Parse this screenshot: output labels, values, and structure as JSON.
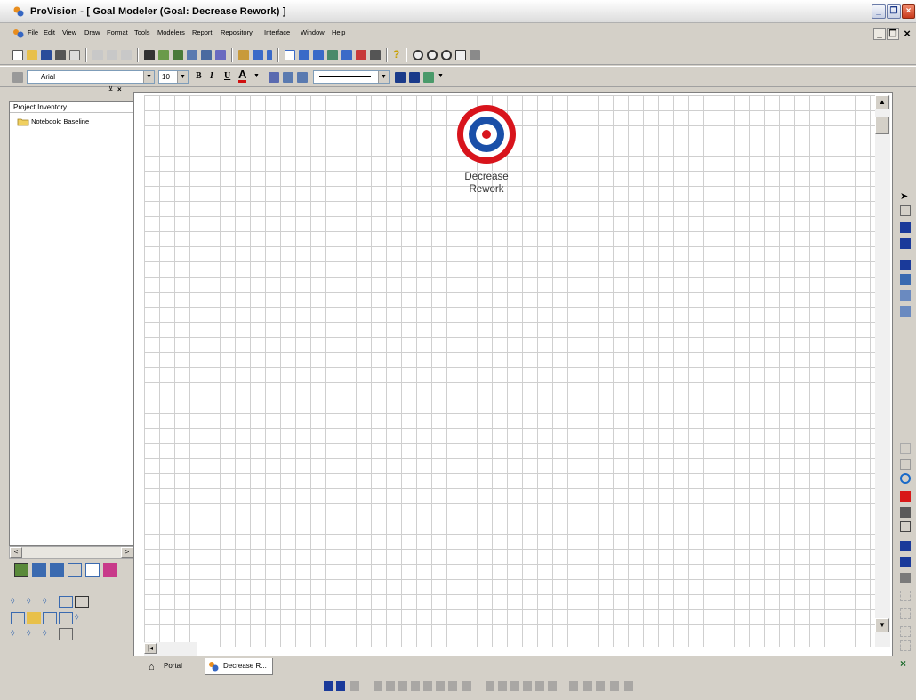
{
  "window": {
    "title": "ProVision - [ Goal Modeler (Goal: Decrease Rework) ]",
    "minimize": "_",
    "restore": "❐",
    "close": "×"
  },
  "menu": {
    "items": [
      "File",
      "Edit",
      "View",
      "Draw",
      "Format",
      "Tools",
      "Modelers",
      "Report",
      "Repository",
      "Interface",
      "Window",
      "Help"
    ],
    "mdi_minimize": "_",
    "mdi_restore": "❐",
    "mdi_close": "×"
  },
  "format_toolbar": {
    "font": "Arial",
    "size": "10",
    "bold": "B",
    "italic": "I",
    "underline": "U",
    "font_color": "A"
  },
  "inventory": {
    "header": "Project Inventory",
    "items": [
      {
        "label": "Notebook: Baseline",
        "icon": "folder-icon"
      }
    ]
  },
  "canvas": {
    "goal": {
      "label_line1": "Decrease",
      "label_line2": "Rework",
      "icon": "target-icon"
    }
  },
  "tabs": [
    {
      "label": "Portal",
      "icon": "portal-icon"
    },
    {
      "label": "Decrease R...",
      "icon": "goal-modeler-icon"
    }
  ],
  "colors": {
    "target_red": "#d8141c",
    "target_blue": "#1a4fa8",
    "grid": "#cfcfcf"
  }
}
